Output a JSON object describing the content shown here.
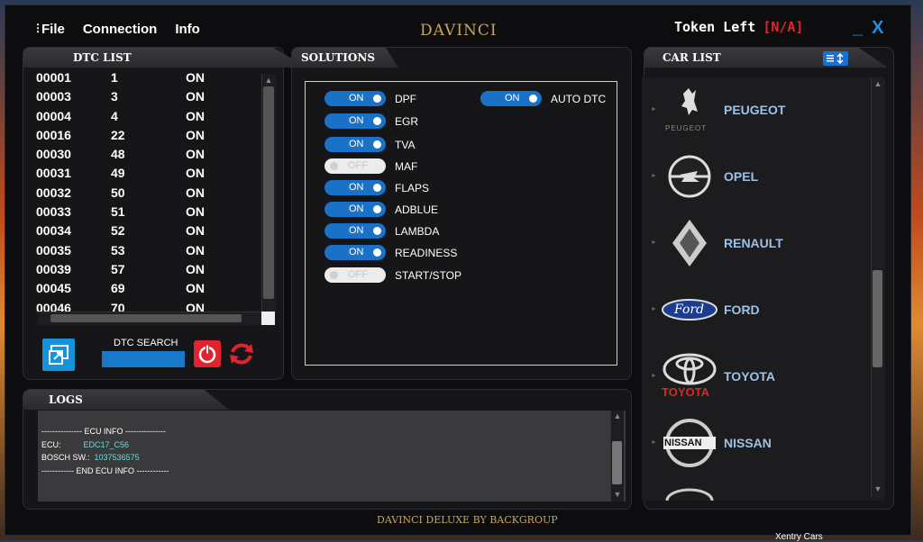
{
  "menu": {
    "file": "File",
    "connection": "Connection",
    "info": "Info"
  },
  "title": "DAVINCI",
  "token": {
    "label": "Token Left",
    "value": "[N/A]"
  },
  "window_controls": {
    "minimize": "_",
    "close": "X"
  },
  "dtc_panel": {
    "title": "DTC LIST",
    "rows": [
      {
        "code": "00001",
        "num": "1",
        "state": "ON"
      },
      {
        "code": "00003",
        "num": "3",
        "state": "ON"
      },
      {
        "code": "00004",
        "num": "4",
        "state": "ON"
      },
      {
        "code": "00016",
        "num": "22",
        "state": "ON"
      },
      {
        "code": "00030",
        "num": "48",
        "state": "ON"
      },
      {
        "code": "00031",
        "num": "49",
        "state": "ON"
      },
      {
        "code": "00032",
        "num": "50",
        "state": "ON"
      },
      {
        "code": "00033",
        "num": "51",
        "state": "ON"
      },
      {
        "code": "00034",
        "num": "52",
        "state": "ON"
      },
      {
        "code": "00035",
        "num": "53",
        "state": "ON"
      },
      {
        "code": "00039",
        "num": "57",
        "state": "ON"
      },
      {
        "code": "00045",
        "num": "69",
        "state": "ON"
      },
      {
        "code": "00046",
        "num": "70",
        "state": "ON"
      }
    ],
    "search_label": "DTC SEARCH"
  },
  "solutions_panel": {
    "title": "SOLUTIONS",
    "items": [
      {
        "label": "DPF",
        "state": "ON"
      },
      {
        "label": "EGR",
        "state": "ON"
      },
      {
        "label": "TVA",
        "state": "ON"
      },
      {
        "label": "MAF",
        "state": "OFF"
      },
      {
        "label": "FLAPS",
        "state": "ON"
      },
      {
        "label": "ADBLUE",
        "state": "ON"
      },
      {
        "label": "LAMBDA",
        "state": "ON"
      },
      {
        "label": "READINESS",
        "state": "ON"
      },
      {
        "label": "START/STOP",
        "state": "OFF"
      }
    ],
    "auto_dtc": {
      "label": "AUTO DTC",
      "state": "ON"
    }
  },
  "logs_panel": {
    "title": "LOGS",
    "line1": "--------------- ECU INFO ---------------",
    "ecu_label": "ECU:",
    "ecu_value": "EDC17_C56",
    "bosch_label": "BOSCH SW.:",
    "bosch_value": "1037536575",
    "line4": "------------ END ECU INFO ------------"
  },
  "car_panel": {
    "title": "CAR LIST",
    "cars": [
      {
        "name": "PEUGEOT",
        "logo_text": "PEUGEOT"
      },
      {
        "name": "OPEL"
      },
      {
        "name": "RENAULT"
      },
      {
        "name": "FORD",
        "logo_text": "Ford"
      },
      {
        "name": "TOYOTA",
        "logo_text": "TOYOTA"
      },
      {
        "name": "NISSAN",
        "logo_text": "NISSAN"
      }
    ]
  },
  "footer": "DAVINCI DELUXE BY BACKGROUP",
  "taskbar_text": "Xentry Cars"
}
